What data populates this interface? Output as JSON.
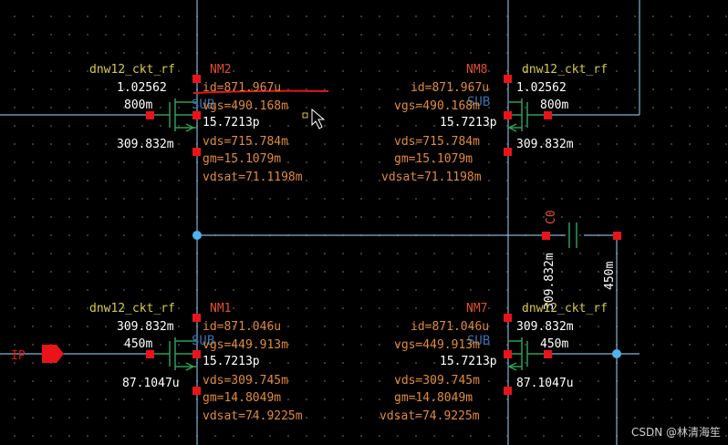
{
  "colors": {
    "wire": "#7fb2d6",
    "device": "#2e9e55",
    "pin": "#e8141a",
    "cell_name": "#d8c94a",
    "inst_name": "#e0502a",
    "op_value": "#e08a3c",
    "param": "#ffffff",
    "sub": "#3a6fb0",
    "annotation": "#e8141a"
  },
  "devices": {
    "nm2": {
      "cell": "dnw12_ckt_rf",
      "name": "NM2",
      "mult": "1.02562",
      "length": "800m",
      "cap": "15.7213p",
      "id": "id=871.967u",
      "vgs": "vgs=490.168m",
      "vds": "vds=715.784m",
      "gm": "gm=15.1079m",
      "vdsat": "vdsat=71.1198m",
      "vb": "309.832m",
      "sub": "SUB"
    },
    "nm8": {
      "cell": "dnw12_ckt_rf",
      "name": "NM8",
      "mult": "1.02562",
      "length": "800m",
      "cap": "15.7213p",
      "id": "id=871.967u",
      "vgs": "vgs=490.168m",
      "vds": "vds=715.784m",
      "gm": "gm=15.1079m",
      "vdsat": "vdsat=71.1198m",
      "vb": "309.832m",
      "sub": "SUB"
    },
    "nm1": {
      "cell": "dnw12_ckt_rf",
      "name": "NM1",
      "mult": "309.832m",
      "length": "450m",
      "cap": "15.7213p",
      "id": "id=871.046u",
      "vgs": "vgs=449.913m",
      "vds": "vds=309.745m",
      "gm": "gm=14.8049m",
      "vdsat": "vdsat=74.9225m",
      "vb": "87.1047u",
      "sub": "SUB"
    },
    "nm7": {
      "cell": "dnw12_ckt_rf",
      "name": "NM7",
      "mult": "309.832m",
      "length": "450m",
      "cap": "15.7213p",
      "id": "id=871.046u",
      "vgs": "vgs=449.913m",
      "vds": "vds=309.745m",
      "gm": "gm=14.8049m",
      "vdsat": "vdsat=74.9225m",
      "vb": "87.1047u",
      "sub": "SUB"
    }
  },
  "capacitor": {
    "name": "C0",
    "left_net": "309.832m",
    "right_net": "450m"
  },
  "pin_ip": "IP",
  "watermark": "CSDN @林清海笙"
}
